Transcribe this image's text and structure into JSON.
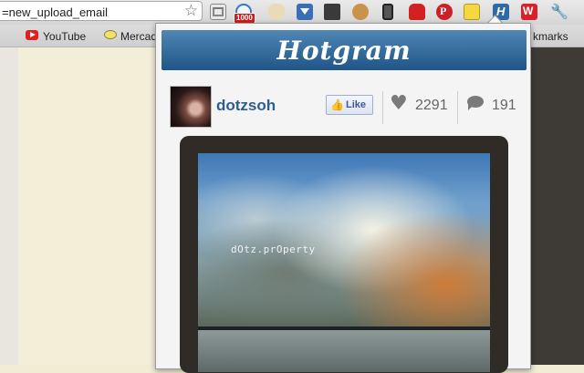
{
  "browser": {
    "url_fragment": "=new_upload_email",
    "bookmark_youtube": "YouTube",
    "bookmark_mercado": "Mercad",
    "other_bookmarks_fragment": "kmarks",
    "badge_count": "1000",
    "extensions": [
      "gmail-icon",
      "notifier-icon",
      "cup-icon",
      "download-icon",
      "monitor-icon",
      "cookie-icon",
      "phone-icon",
      "sofa-icon",
      "pinterest-icon",
      "magnifier-icon",
      "hotgram-icon",
      "w-icon",
      "wrench-icon"
    ]
  },
  "popup": {
    "title": "Hotgram",
    "post": {
      "username": "dotzsoh",
      "like_label": "Like",
      "likes_count": "2291",
      "comments_count": "191",
      "watermark": "dOtz.prOperty"
    }
  },
  "colors": {
    "header_top": "#4f86b3",
    "header_bottom": "#1f5688",
    "username": "#2c5f8f",
    "frame": "#2f2b27"
  }
}
